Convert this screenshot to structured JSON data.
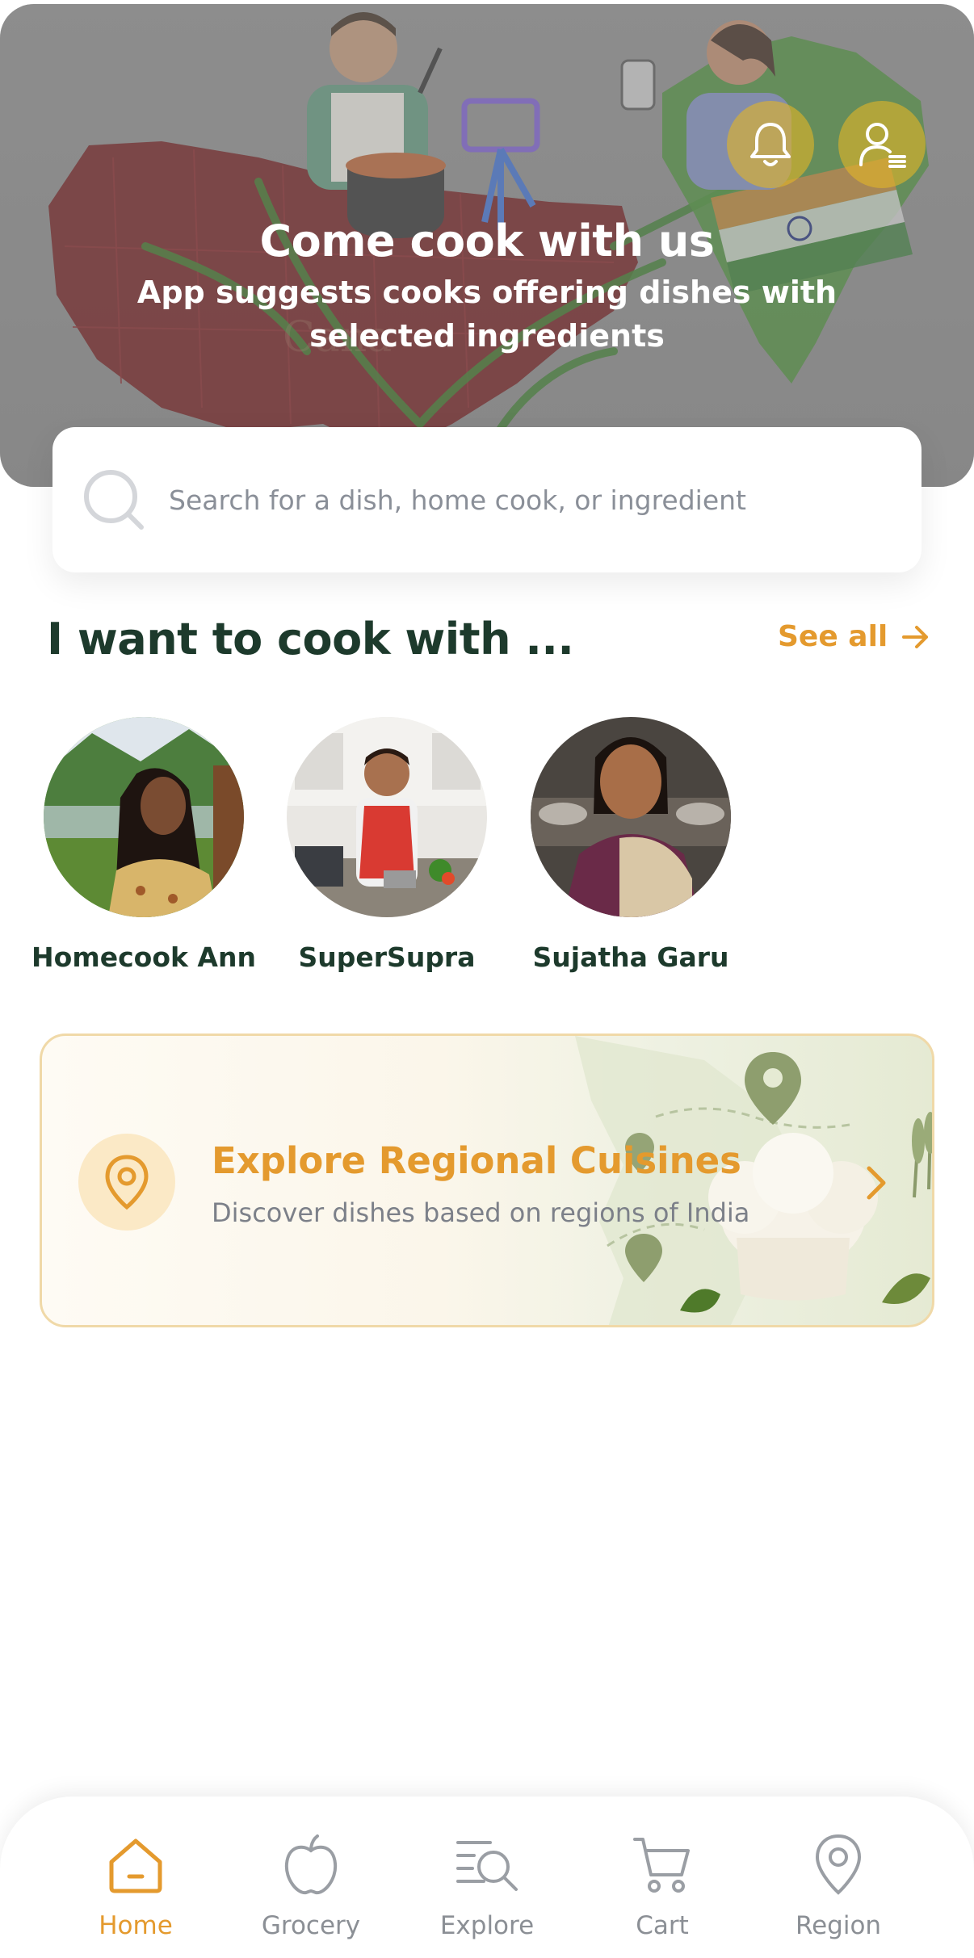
{
  "hero": {
    "title": "Come cook with us",
    "subtitle": "App suggests cooks offering dishes with selected ingredients",
    "notification_icon": "bell-icon",
    "profile_icon": "user-menu-icon"
  },
  "search": {
    "placeholder": "Search for a dish, home cook, or ingredient",
    "icon": "search-icon"
  },
  "cooks_section": {
    "title": "I want to cook with ...",
    "see_all_label": "See all",
    "cooks": [
      {
        "name": "Homecook Ann"
      },
      {
        "name": "SuperSupra"
      },
      {
        "name": "Sujatha Garu"
      }
    ]
  },
  "regional_card": {
    "title": "Explore Regional Cuisines",
    "description": "Discover dishes based on regions of India",
    "icon": "location-pin-icon"
  },
  "bottom_nav": {
    "items": [
      {
        "label": "Home",
        "icon": "home-icon",
        "active": true
      },
      {
        "label": "Grocery",
        "icon": "apple-icon",
        "active": false
      },
      {
        "label": "Explore",
        "icon": "explore-search-icon",
        "active": false
      },
      {
        "label": "Cart",
        "icon": "cart-icon",
        "active": false
      },
      {
        "label": "Region",
        "icon": "map-pin-icon",
        "active": false
      }
    ]
  },
  "colors": {
    "accent": "#e49a2e",
    "heading": "#1d3a2c",
    "muted": "#8b8f95"
  }
}
